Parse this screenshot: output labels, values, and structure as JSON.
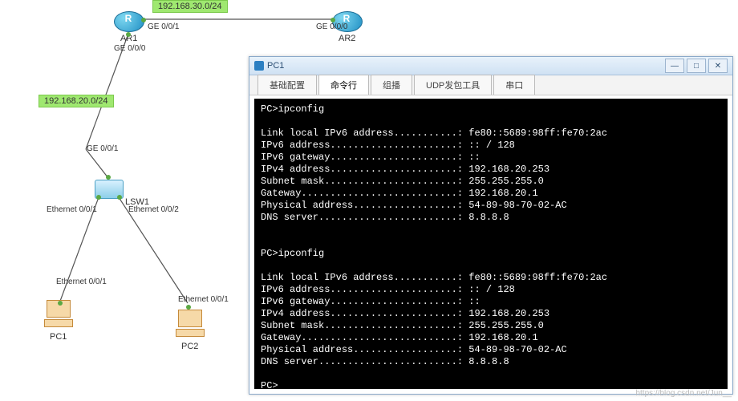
{
  "topology": {
    "subnets": {
      "top": "192.168.30.0/24",
      "left": "192.168.20.0/24"
    },
    "devices": {
      "ar1": {
        "label": "AR1"
      },
      "ar2": {
        "label": "AR2"
      },
      "lsw1": {
        "label": "LSW1"
      },
      "pc1": {
        "label": "PC1"
      },
      "pc2": {
        "label": "PC2"
      }
    },
    "ports": {
      "ar1_right": "GE 0/0/1",
      "ar2_left": "GE 0/0/0",
      "ar1_down": "GE 0/0/0",
      "lsw1_up": "GE 0/0/1",
      "lsw1_left": "Ethernet 0/0/1",
      "lsw1_right": "Ethernet 0/0/2",
      "pc1_port": "Ethernet 0/0/1",
      "pc2_port": "Ethernet 0/0/1"
    }
  },
  "window": {
    "title": "PC1",
    "tabs": {
      "basic": "基础配置",
      "cli": "命令行",
      "multicast": "组播",
      "udp": "UDP发包工具",
      "serial": "串口"
    },
    "terminal": "PC>ipconfig\n\nLink local IPv6 address...........: fe80::5689:98ff:fe70:2ac\nIPv6 address......................: :: / 128\nIPv6 gateway......................: ::\nIPv4 address......................: 192.168.20.253\nSubnet mask.......................: 255.255.255.0\nGateway...........................: 192.168.20.1\nPhysical address..................: 54-89-98-70-02-AC\nDNS server........................: 8.8.8.8\n\n\nPC>ipconfig\n\nLink local IPv6 address...........: fe80::5689:98ff:fe70:2ac\nIPv6 address......................: :: / 128\nIPv6 gateway......................: ::\nIPv4 address......................: 192.168.20.253\nSubnet mask.......................: 255.255.255.0\nGateway...........................: 192.168.20.1\nPhysical address..................: 54-89-98-70-02-AC\nDNS server........................: 8.8.8.8\n\nPC>"
  },
  "watermark": "https://blog.csdn.net/Jun__"
}
